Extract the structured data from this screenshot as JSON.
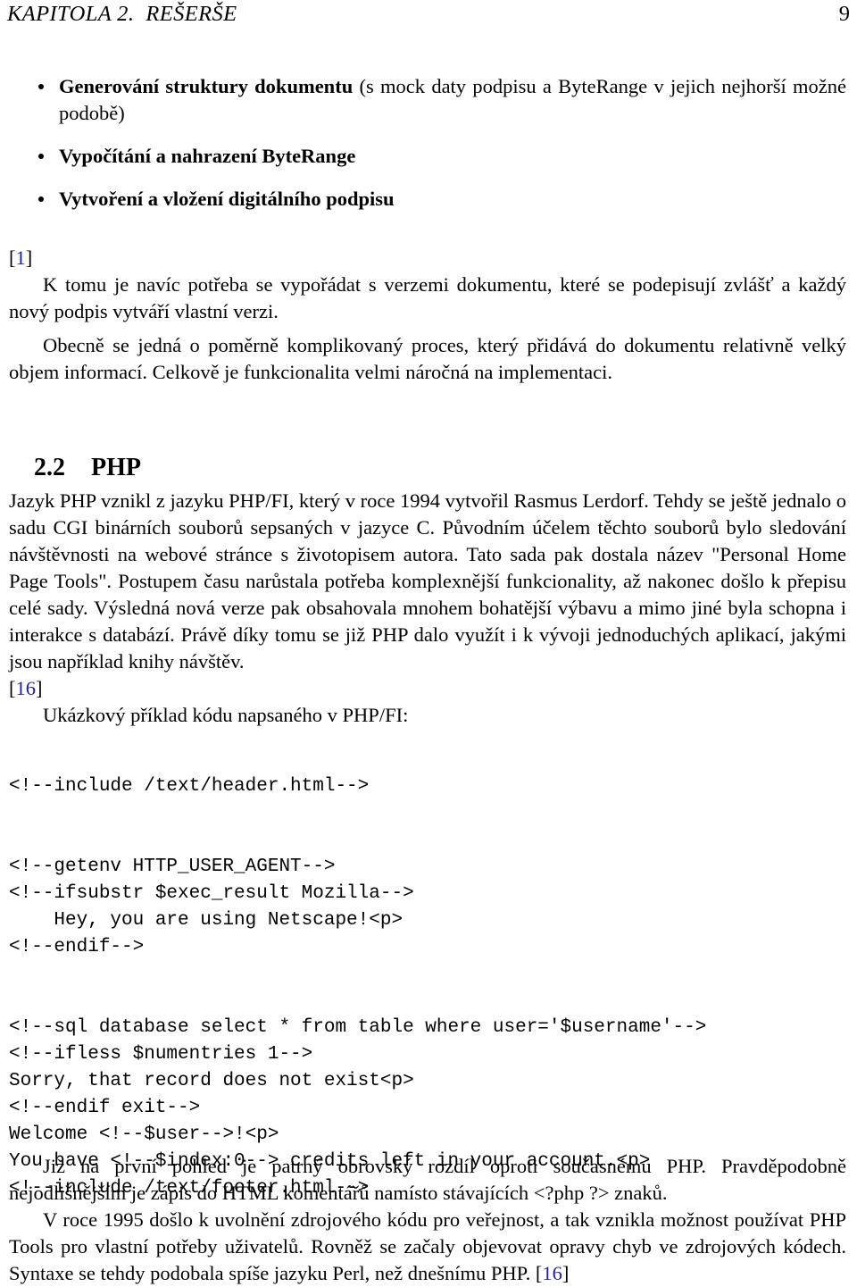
{
  "document": {
    "language": "cs",
    "running_head": {
      "chapter_label": "KAPITOLA 2.  REŠERŠE",
      "page_number": "9"
    }
  },
  "bullet_list": {
    "items": [
      {
        "bold_part": "Generování struktury dokumentu",
        "rest": " (s mock daty podpisu a ByteRange v jejich nejhorší možné podobě)"
      },
      {
        "bold_part": "Vypočítání a nahrazení ByteRange",
        "rest": ""
      },
      {
        "bold_part": "Vytvoření a vložení digitálního podpisu",
        "rest": ""
      }
    ]
  },
  "citations": {
    "first": {
      "open": "[",
      "num": "1",
      "close": "]"
    },
    "php_source": {
      "open": "[",
      "num": "16",
      "close": "]"
    },
    "last": {
      "open": "[",
      "num": "16",
      "close": "]"
    }
  },
  "paragraphs": {
    "p_versions": "K tomu je navíc potřeba se vypořádat s verzemi dokumentu, které se podepisují zvlášť a každý nový podpis vytváří vlastní verzi.",
    "p_complexity": "Obecně se jedná o poměrně komplikovaný proces, který přidává do dokumentu relativně velký objem informací. Celkově je funkcionalita velmi náročná na implementaci.",
    "p_php_history": "Jazyk PHP vznikl z jazyku PHP/FI, který v roce 1994 vytvořil Rasmus Lerdorf. Tehdy se ještě jednalo o sadu CGI binárních souborů sepsaných v jazyce C. Původním účelem těchto souborů bylo sledování návštěvnosti na webové stránce s životopisem autora. Tato sada pak dostala název \"Personal Home Page Tools\". Postupem času narůstala potřeba komplexnější funkcionality, až nakonec došlo k přepisu celé sady. Výsledná nová verze pak obsahovala mnohem bohatější výbavu a mimo jiné byla schopna i interakce s databází. Právě díky tomu se již PHP dalo využít i k vývoji jednoduchých aplikací, jakými jsou například knihy návštěv.",
    "p_code_intro": "Ukázkový příklad kódu napsaného v PHP/FI:",
    "p_difference": "Již na první pohled je patrný obrovský rozdíl oproti současnému PHP. Pravděpodobně nejodlišnějším je zápis do HTML komentářů namísto stávajících <?php ?> znaků.",
    "p_1995": "V roce 1995 došlo k uvolnění zdrojového kódu pro veřejnost, a tak vznikla možnost používat PHP Tools pro vlastní potřeby uživatelů. Rovněž se začaly objevovat opravy chyb ve zdrojových kódech. Syntaxe se tehdy podobala spíše jazyku Perl, než dnešnímu PHP."
  },
  "section": {
    "number": "2.2",
    "title": "PHP"
  },
  "code_block": {
    "language": "php-fi",
    "lines": [
      "<!--include /text/header.html-->",
      "",
      "",
      "<!--getenv HTTP_USER_AGENT-->",
      "<!--ifsubstr $exec_result Mozilla-->",
      "    Hey, you are using Netscape!<p>",
      "<!--endif-->",
      "",
      "",
      "<!--sql database select * from table where user='$username'-->",
      "<!--ifless $numentries 1-->",
      "Sorry, that record does not exist<p>",
      "<!--endif exit-->",
      "Welcome <!--$user-->!<p>",
      "You have <!--$index:0--> credits left in your account.<p>",
      "<!--include /text/footer.html-->"
    ]
  },
  "colors": {
    "text": "#000000",
    "citation_link": "#1f1fa8",
    "page_background": "#ffffff"
  }
}
